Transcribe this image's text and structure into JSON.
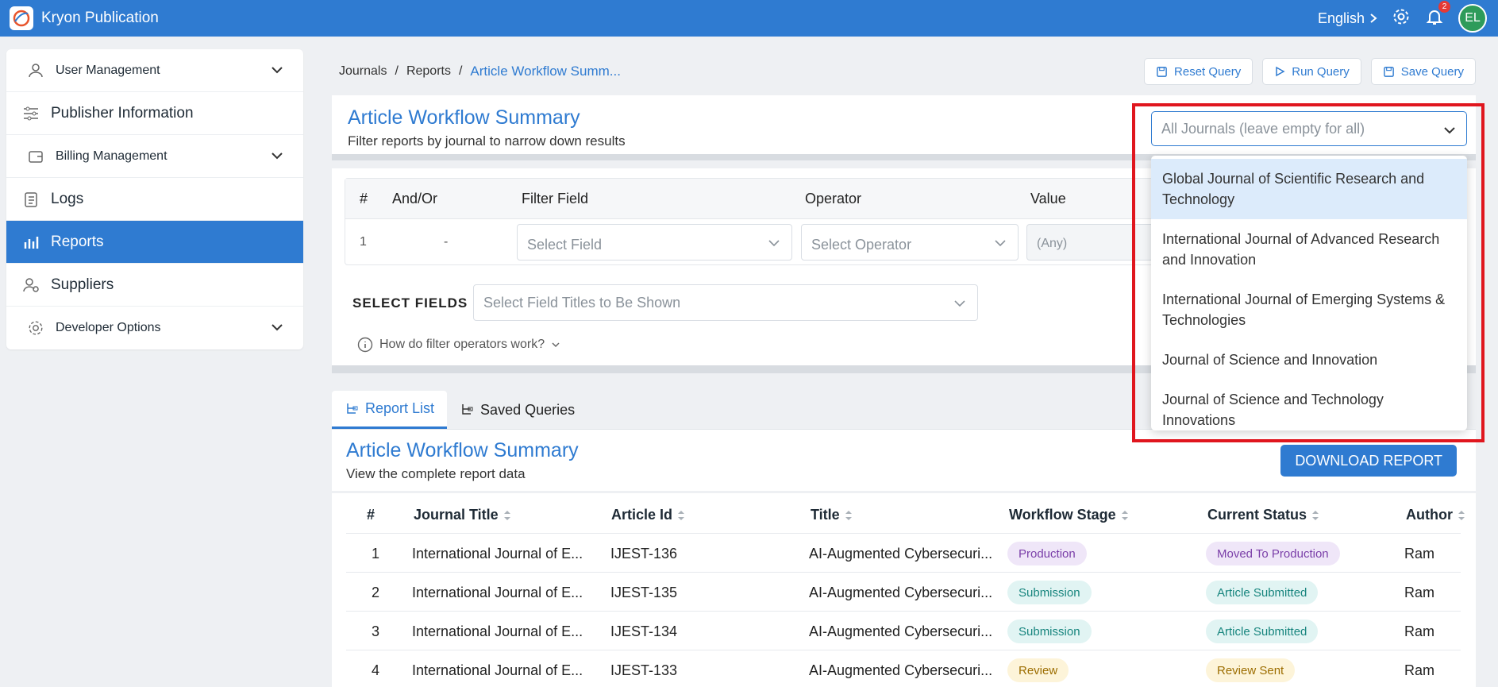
{
  "app": {
    "title": "Kryon Publication"
  },
  "topbar": {
    "language": "English",
    "notifications_count": "2",
    "avatar_initials": "EL"
  },
  "sidebar": {
    "items": [
      {
        "label": "User Management",
        "icon": "users-icon",
        "expandable": true
      },
      {
        "label": "Publisher Information",
        "icon": "sliders-icon",
        "expandable": false
      },
      {
        "label": "Billing Management",
        "icon": "wallet-icon",
        "expandable": true
      },
      {
        "label": "Logs",
        "icon": "notebook-icon",
        "expandable": false
      },
      {
        "label": "Reports",
        "icon": "chart-icon",
        "expandable": false,
        "active": true
      },
      {
        "label": "Suppliers",
        "icon": "supplier-icon",
        "expandable": false
      },
      {
        "label": "Developer Options",
        "icon": "gear-icon",
        "expandable": true
      }
    ]
  },
  "breadcrumb": {
    "items": [
      "Journals",
      "Reports"
    ],
    "current": "Article Workflow Summ..."
  },
  "actions": {
    "reset": "Reset Query",
    "run": "Run Query",
    "save": "Save Query"
  },
  "header": {
    "title": "Article Workflow Summary",
    "subtitle": "Filter reports by journal to narrow down results"
  },
  "journal_select": {
    "placeholder": "All Journals (leave empty for all)",
    "options": [
      "Global Journal of Scientific Research and Technology",
      "International Journal of Advanced Research and Innovation",
      "International Journal of Emerging Systems & Technologies",
      "Journal of Science and Innovation",
      "Journal of Science and Technology Innovations"
    ]
  },
  "filter": {
    "columns": {
      "num": "#",
      "andor": "And/Or",
      "field": "Filter Field",
      "operator": "Operator",
      "value": "Value"
    },
    "row": {
      "num": "1",
      "andor": "-",
      "field_placeholder": "Select Field",
      "operator_placeholder": "Select Operator",
      "value_placeholder": "(Any)"
    },
    "select_fields_label": "SELECT FIELDS :",
    "select_fields_placeholder": "Select Field Titles to Be Shown",
    "help": "How do filter operators work?"
  },
  "tabs": {
    "report_list": "Report List",
    "saved_queries": "Saved Queries"
  },
  "report": {
    "title": "Article Workflow Summary",
    "subtitle": "View the complete report data",
    "download": "DOWNLOAD REPORT",
    "columns": {
      "num": "#",
      "journal": "Journal Title",
      "article_id": "Article Id",
      "title": "Title",
      "stage": "Workflow Stage",
      "status": "Current Status",
      "author": "Author"
    },
    "rows": [
      {
        "num": "1",
        "journal": "International Journal of E...",
        "article_id": "IJEST-136",
        "title": "AI-Augmented Cybersecuri...",
        "stage": "Production",
        "status": "Moved To Production",
        "author": "Ram"
      },
      {
        "num": "2",
        "journal": "International Journal of E...",
        "article_id": "IJEST-135",
        "title": "AI-Augmented Cybersecuri...",
        "stage": "Submission",
        "status": "Article Submitted",
        "author": "Ram"
      },
      {
        "num": "3",
        "journal": "International Journal of E...",
        "article_id": "IJEST-134",
        "title": "AI-Augmented Cybersecuri...",
        "stage": "Submission",
        "status": "Article Submitted",
        "author": "Ram"
      },
      {
        "num": "4",
        "journal": "International Journal of E...",
        "article_id": "IJEST-133",
        "title": "AI-Augmented Cybersecuri...",
        "stage": "Review",
        "status": "Review Sent",
        "author": "Ram"
      }
    ]
  },
  "colors": {
    "primary": "#2f7bd1",
    "highlight_border": "#e0161e"
  }
}
